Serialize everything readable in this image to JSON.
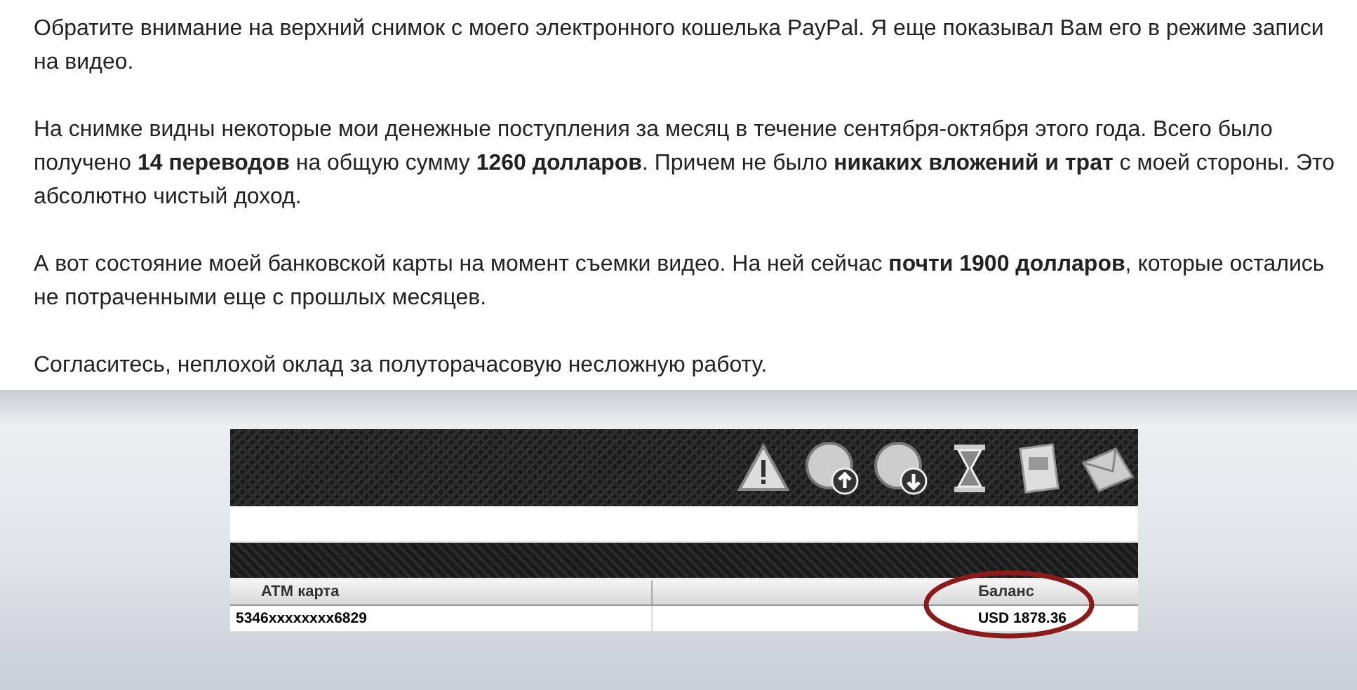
{
  "article": {
    "paragraphs": [
      "Обратите внимание на верхний снимок с моего электронного кошелька PayPal. Я еще показывал Вам его в режиме записи на видео.",
      "На снимке видны некоторые мои денежные поступления за месяц в течение сентября-октября этого года. Всего было получено **14 переводов** на общую сумму **1260 долларов**. Причем не было **никаких вложений и трат** с моей стороны. Это абсолютно чистый доход.",
      "А вот состояние моей банковской карты на момент съемки видео. На ней сейчас **почти 1900 долларов**, которые остались не потраченными еще с прошлых месяцев.",
      "Согласитесь, неплохой оклад за полуторачасовую несложную работу."
    ]
  },
  "screenshot": {
    "table": {
      "columns": [
        {
          "label": "ATM карта"
        },
        {
          "label": "Баланс"
        }
      ],
      "rows": [
        {
          "card": "5346xxxxxxxx6829",
          "balance": "USD 1878.36",
          "highlighted": true
        }
      ]
    }
  }
}
